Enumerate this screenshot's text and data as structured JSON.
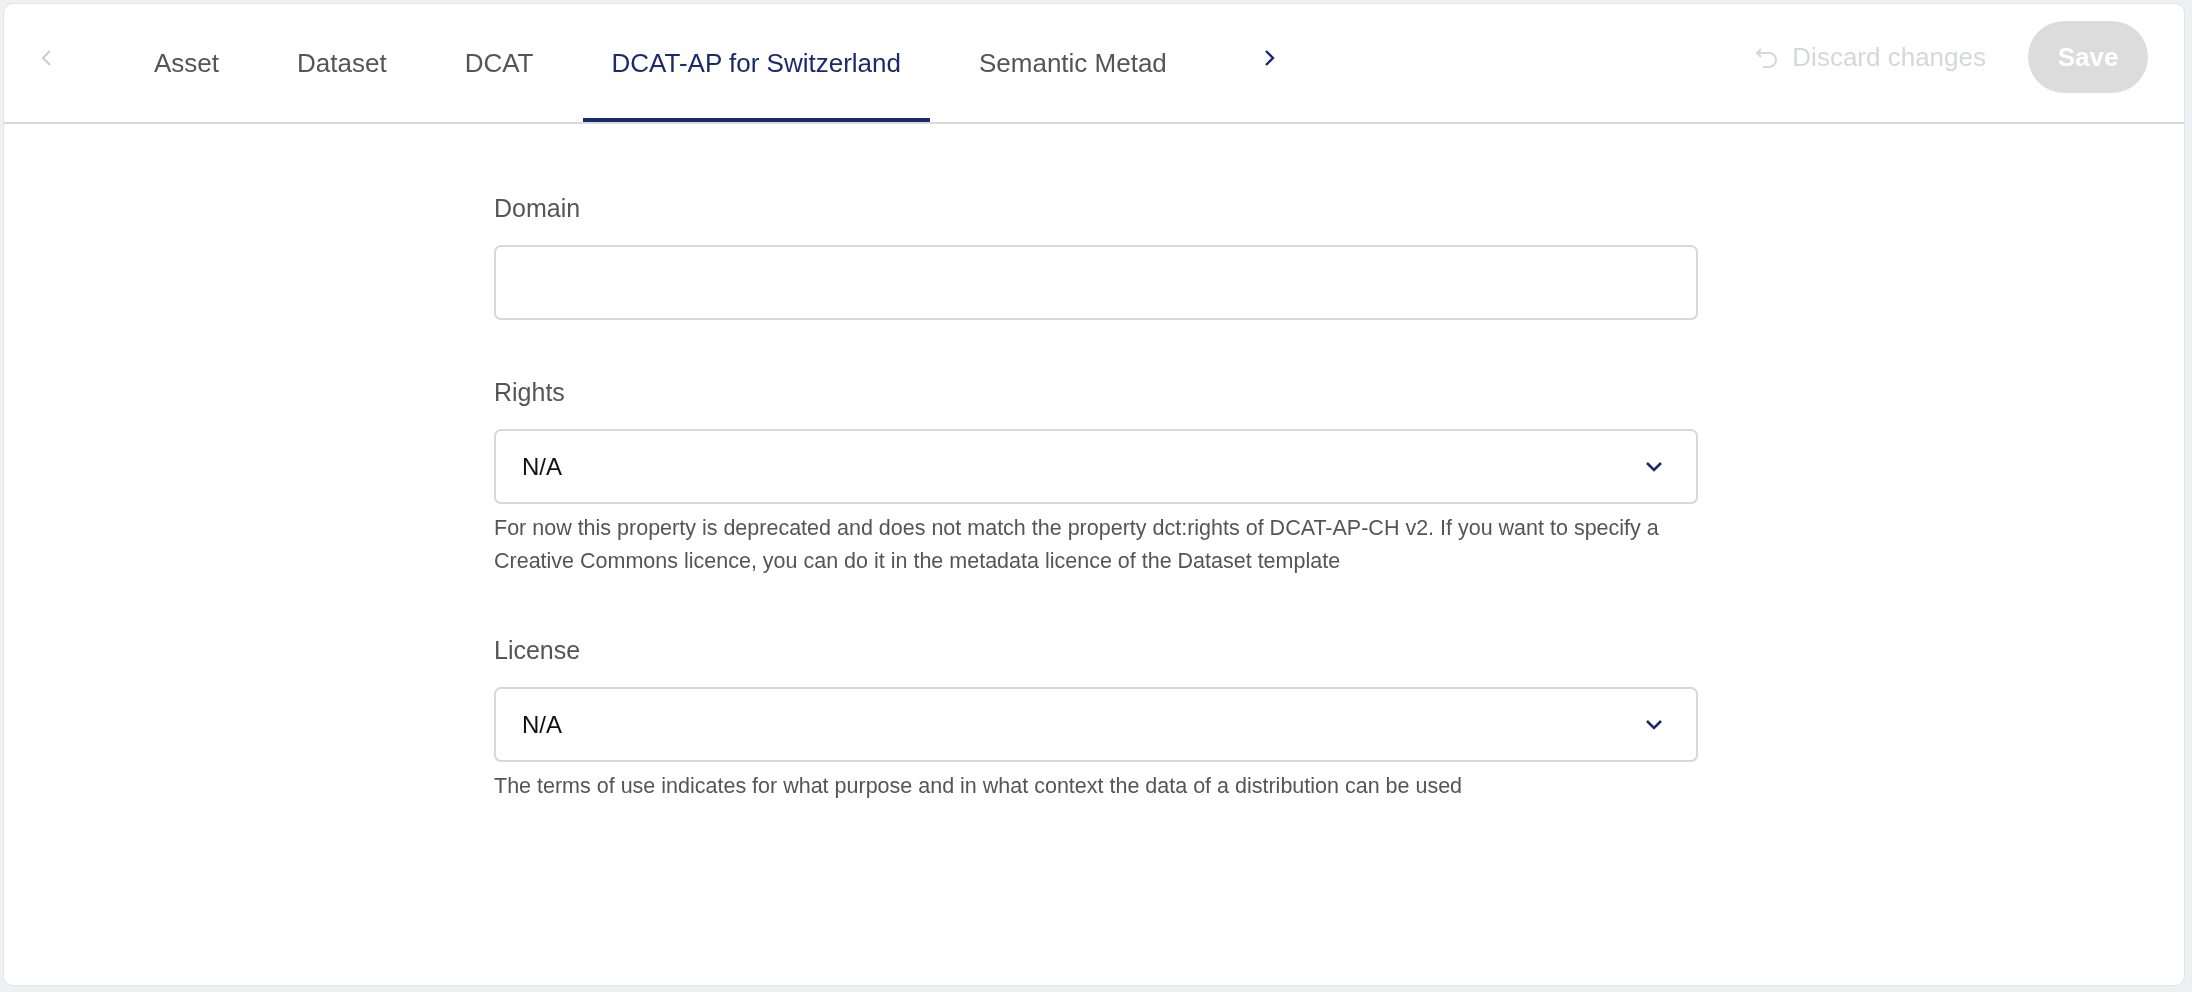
{
  "tab_bar": {
    "prev_arrow": {
      "disabled": true
    },
    "next_arrow": {
      "disabled": false
    },
    "tabs": [
      {
        "label": "Asset",
        "selected": false
      },
      {
        "label": "Dataset",
        "selected": false
      },
      {
        "label": "DCAT",
        "selected": false
      },
      {
        "label": "DCAT-AP for Switzerland",
        "selected": true
      },
      {
        "label": "Semantic Metad",
        "selected": false
      }
    ],
    "discard_button": {
      "label": "Discard changes",
      "disabled": true
    },
    "save_button": {
      "label": "Save",
      "disabled": true
    }
  },
  "form": {
    "fields": [
      {
        "kind": "text",
        "label": "Domain"
      },
      {
        "kind": "select",
        "label": "Rights",
        "value": "N/A",
        "help": "For now this property is deprecated and does not match the property dct:rights of DCAT-AP-CH v2. If you want to specify a Creative Commons licence, you can do it in the metadata licence of the Dataset template"
      },
      {
        "kind": "select",
        "label": "License",
        "value": "N/A",
        "help": "The terms of use indicates for what purpose and in what context the data of a distribution can be used"
      }
    ]
  }
}
